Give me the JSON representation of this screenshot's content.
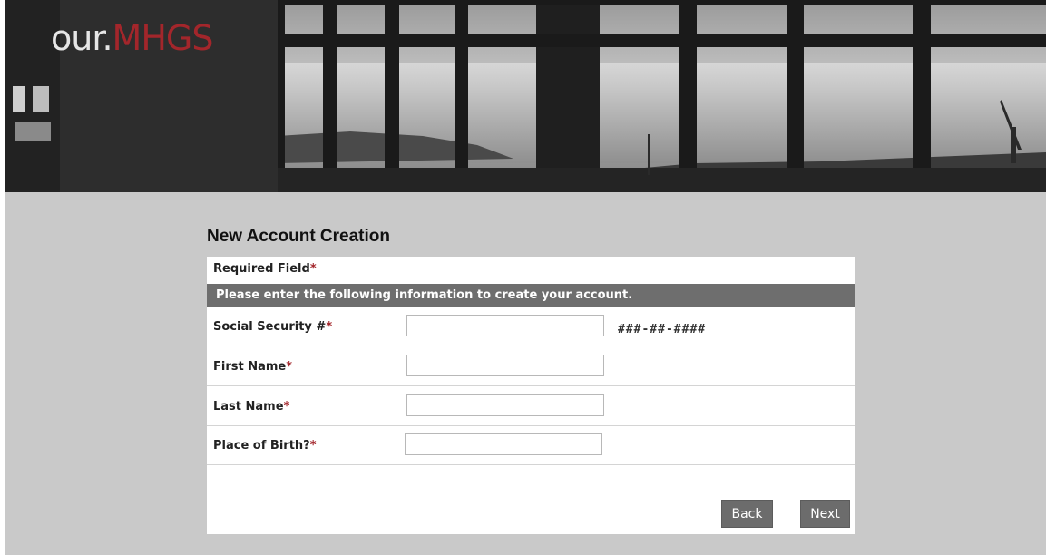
{
  "banner": {
    "logo_prefix": "our.",
    "logo_brand": "MHGS"
  },
  "form": {
    "title": "New Account Creation",
    "required_label": "Required Field",
    "required_star": "*",
    "instructions": "Please enter the following information to create your account.",
    "fields": [
      {
        "label": "Social Security #",
        "star": "*",
        "value": "",
        "placeholder": "",
        "hint": "###-##-####"
      },
      {
        "label": "First Name",
        "star": "*",
        "value": "",
        "placeholder": ""
      },
      {
        "label": "Last Name",
        "star": "*",
        "value": "",
        "placeholder": ""
      },
      {
        "label": "Place of Birth?",
        "star": "*",
        "value": "",
        "placeholder": ""
      }
    ],
    "back_label": "Back",
    "next_label": "Next"
  },
  "colors": {
    "accent": "#a3262b",
    "page_bg": "#c9c9c9",
    "instruction_bar": "#6e6e6e",
    "button_bg": "#6c6c6c"
  }
}
